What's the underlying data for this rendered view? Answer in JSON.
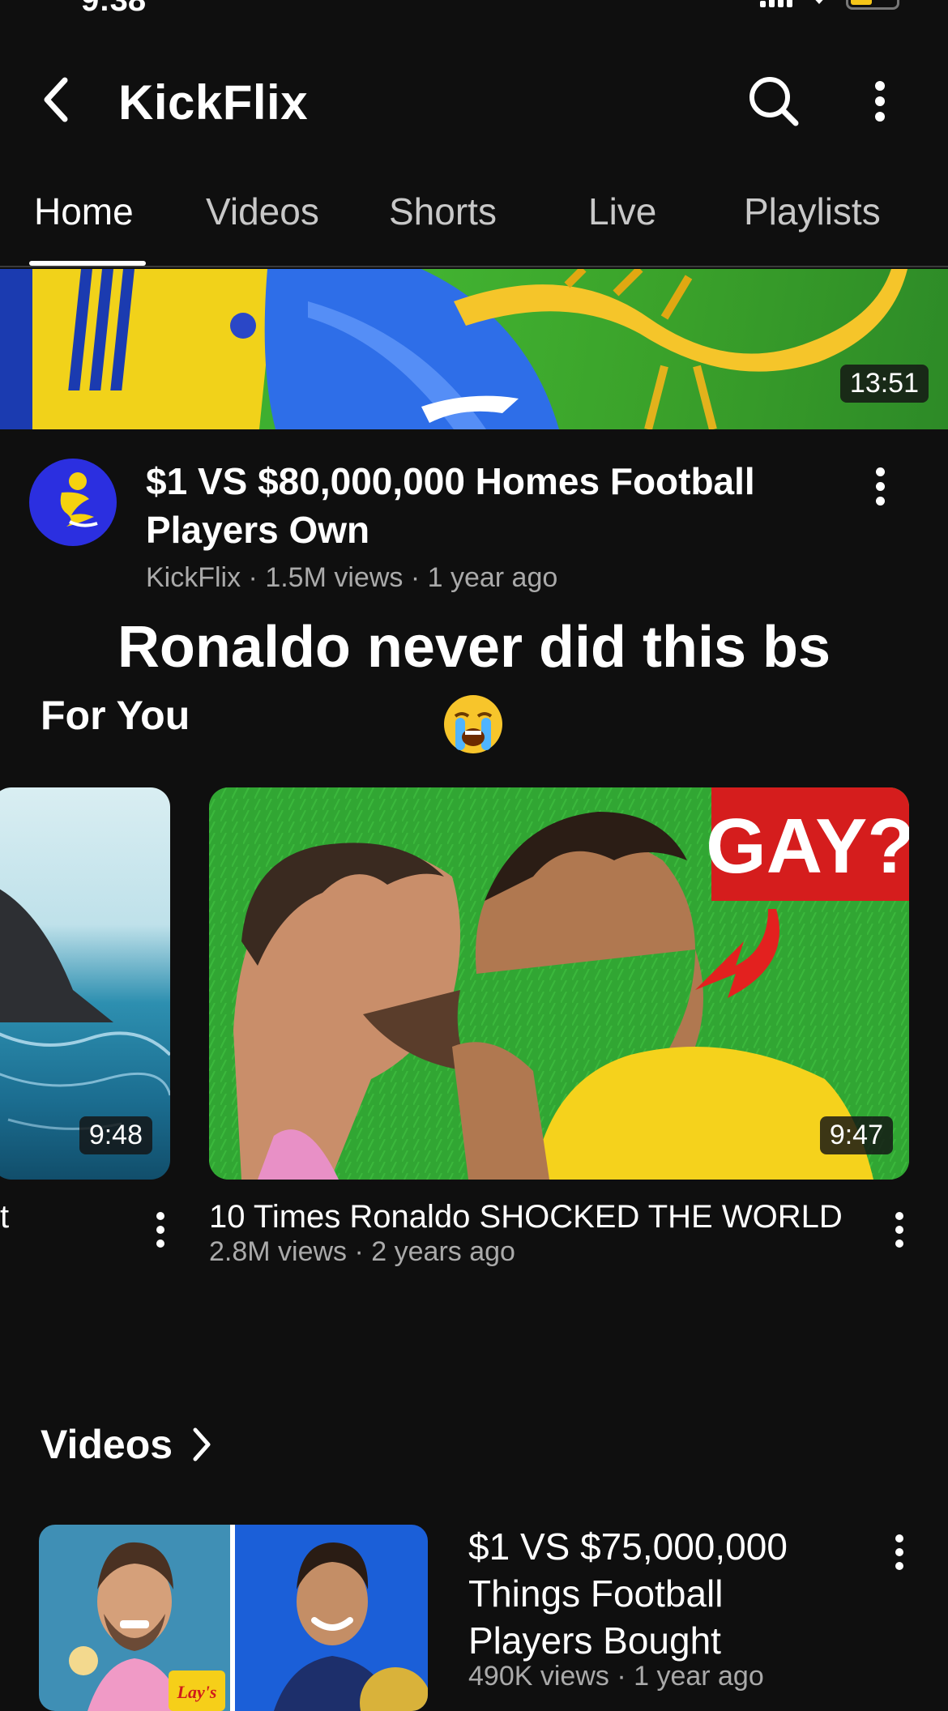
{
  "status_bar": {
    "time": "9:38"
  },
  "header": {
    "title": "KickFlix"
  },
  "tabs": [
    {
      "label": "Home",
      "active": true
    },
    {
      "label": "Videos"
    },
    {
      "label": "Shorts"
    },
    {
      "label": "Live"
    },
    {
      "label": "Playlists"
    }
  ],
  "featured": {
    "duration": "13:51",
    "title": "$1 VS $80,000,000 Homes Football Players Own",
    "meta": "KickFlix · 1.5M views · 1 year ago"
  },
  "caption": {
    "text": "Ronaldo never did this bs"
  },
  "for_you": {
    "heading": "For You",
    "left_card": {
      "duration": "9:48",
      "title_fragment": "t"
    },
    "main_card": {
      "thumb_text": "GAY?",
      "duration": "9:47",
      "title": "10 Times Ronaldo SHOCKED THE WORLD",
      "meta": "2.8M views · 2 years ago"
    }
  },
  "videos": {
    "heading": "Videos",
    "item": {
      "title": "$1 VS $75,000,000 Things Football Players Bought",
      "meta": "490K views · 1 year ago",
      "thumb_brand": "Lay's"
    }
  },
  "colors": {
    "background": "#0f0f0f",
    "meta_text": "#aaaaaa",
    "avatar": "#2b2fe0",
    "pitch_green": "#2fa531"
  }
}
